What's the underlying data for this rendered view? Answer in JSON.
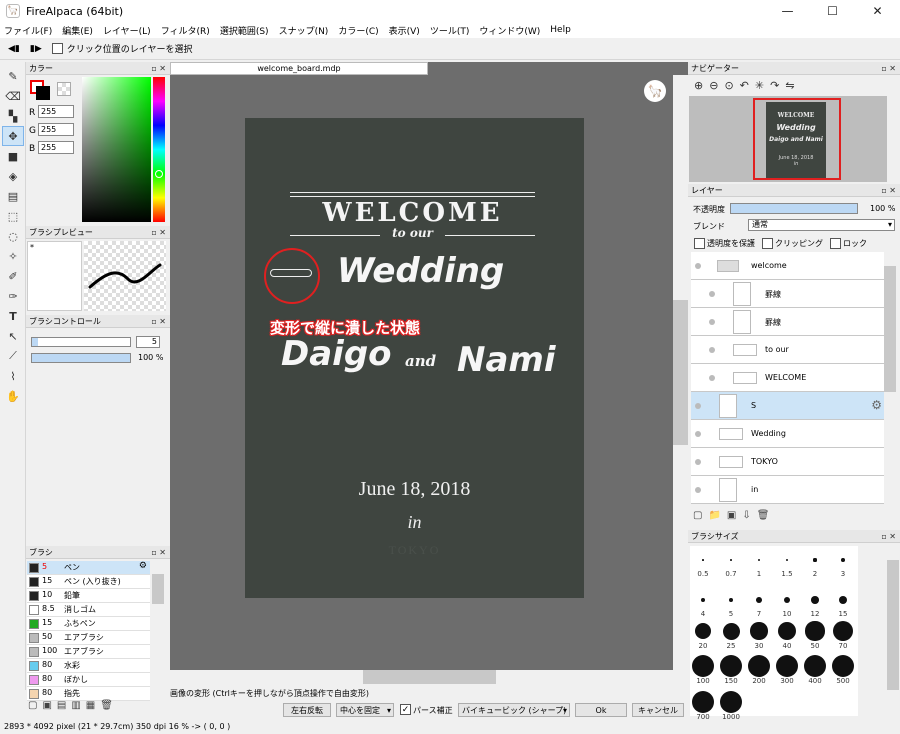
{
  "window": {
    "title": "FireAlpaca (64bit)"
  },
  "menu": [
    "ファイル(F)",
    "編集(E)",
    "レイヤー(L)",
    "フィルタ(R)",
    "選択範囲(S)",
    "スナップ(N)",
    "カラー(C)",
    "表示(V)",
    "ツール(T)",
    "ウィンドウ(W)",
    "Help"
  ],
  "tool_options": {
    "select_layer_label": "クリック位置のレイヤーを選択"
  },
  "color_panel": {
    "title": "カラー",
    "r_label": "R",
    "g_label": "G",
    "b_label": "B",
    "r": "255",
    "g": "255",
    "b": "255"
  },
  "brush_preview": {
    "title": "ブラシプレビュー",
    "marker": "*"
  },
  "brush_control": {
    "title": "ブラシコントロール",
    "size": "5",
    "opacity": "100 %",
    "size_fill": 0.06,
    "opacity_fill": 1.0
  },
  "brush_panel": {
    "title": "ブラシ",
    "items": [
      {
        "size": "5",
        "name": "ペン",
        "color": "#222222",
        "selected": true
      },
      {
        "size": "15",
        "name": "ペン (入り抜き)",
        "color": "#222222"
      },
      {
        "size": "10",
        "name": "鉛筆",
        "color": "#222222"
      },
      {
        "size": "8.5",
        "name": "消しゴム",
        "color": "#ffffff"
      },
      {
        "size": "15",
        "name": "ふちペン",
        "color": "#22aa22"
      },
      {
        "size": "50",
        "name": "エアブラシ",
        "color": "#bbbbbb"
      },
      {
        "size": "100",
        "name": "エアブラシ",
        "color": "#bbbbbb"
      },
      {
        "size": "80",
        "name": "水彩",
        "color": "#66ccee"
      },
      {
        "size": "80",
        "name": "ぼかし",
        "color": "#ee99ee"
      },
      {
        "size": "80",
        "name": "指先",
        "color": "#f5d5b0"
      }
    ]
  },
  "document": {
    "tab": "welcome_board.mdp"
  },
  "board": {
    "welcome": "WELCOME",
    "to_our": "to our",
    "wedding": "Wedding",
    "daigo": "Daigo",
    "and": "and",
    "nami": "Nami",
    "date": "June 18, 2018",
    "in": "in",
    "tokyo": "TOKYO"
  },
  "annotation": {
    "text": "変形で縦に潰した状態",
    "color": "#e02020"
  },
  "navigator": {
    "title": "ナビゲーター"
  },
  "layers": {
    "title": "レイヤー",
    "opacity_label": "不透明度",
    "opacity_value": "100 %",
    "blend_label": "ブレンド",
    "blend_value": "通常",
    "protect_label": "透明度を保護",
    "clip_label": "クリッピング",
    "lock_label": "ロック",
    "items": [
      {
        "name": "welcome",
        "type": "folder"
      },
      {
        "name": "罫線",
        "type": "child"
      },
      {
        "name": "罫線",
        "type": "child"
      },
      {
        "name": "to our",
        "type": "child"
      },
      {
        "name": "WELCOME",
        "type": "child"
      },
      {
        "name": "S",
        "type": "layer",
        "selected": true
      },
      {
        "name": "Wedding",
        "type": "layer"
      },
      {
        "name": "TOKYO",
        "type": "layer"
      },
      {
        "name": "in",
        "type": "layer"
      }
    ]
  },
  "brush_sizes": {
    "title": "ブラシサイズ",
    "rows": [
      [
        "0.5",
        "0.7",
        "1",
        "1.5",
        "2",
        "3"
      ],
      [
        "4",
        "5",
        "7",
        "10",
        "12",
        "15"
      ],
      [
        "20",
        "25",
        "30",
        "40",
        "50",
        "70"
      ],
      [
        "100",
        "150",
        "200",
        "300",
        "400",
        "500"
      ],
      [
        "700",
        "1000"
      ]
    ]
  },
  "transform_bar": {
    "hint": "画像の変形 (Ctrlキーを押しながら頂点操作で自由変形)",
    "flip": "左右反転",
    "center": "中心を固定",
    "perspective": "パース補正",
    "interp": "バイキュービック (シャープ)",
    "ok": "Ok",
    "cancel": "キャンセル"
  },
  "status": {
    "text": "2893 * 4092 pixel   (21 * 29.7cm)   350 dpi   16 %   -> ( 0, 0 )"
  }
}
